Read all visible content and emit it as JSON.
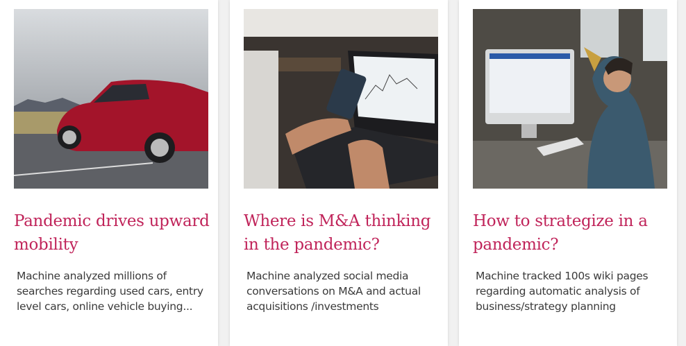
{
  "cards": [
    {
      "title": "Pandemic drives upward mobility",
      "description": "Machine analyzed millions of searches regarding used cars, entry level cars, online vehicle buying...",
      "image": "red-car-photo"
    },
    {
      "title": "Where is M&A thinking in the pandemic?",
      "description": "Machine analyzed social media conversations on M&A and actual acquisitions /investments",
      "image": "laptop-phone-chart-photo"
    },
    {
      "title": "How to strategize in a pandemic?",
      "description": "Machine tracked 100s wiki pages regarding automatic analysis of business/strategy planning",
      "image": "man-at-computer-photo"
    }
  ],
  "colors": {
    "title": "#c0245a",
    "text": "#3a3a3a"
  }
}
